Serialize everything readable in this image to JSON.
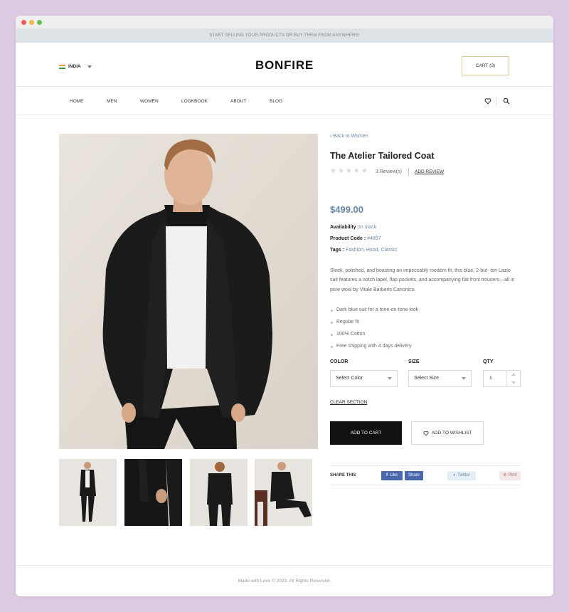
{
  "announcement": "START SELLING YOUR PRODUCTS OR BUY THEM FROM ANYWHERE!",
  "header": {
    "country": "INDIA",
    "logo": "BONFIRE",
    "cart": "CART (3)"
  },
  "nav": {
    "items": [
      "HOME",
      "MEN",
      "WOMEN",
      "LOOKBOOK",
      "ABOUT",
      "BLOG"
    ],
    "icons": [
      "heart-icon",
      "search-icon"
    ]
  },
  "product": {
    "back_label": "Back to Women",
    "title": "The Atelier Tailored Coat",
    "rating": 0,
    "reviews": "3 Review(s)",
    "add_review": "ADD REVIEW",
    "price": "$499.00",
    "availability_label": "Availability :",
    "availability_value": "In stock",
    "code_label": "Product Code :",
    "code_value": "#4657",
    "tags_label": "Tags :",
    "tags_value": "Fashion, Hood, Classic",
    "description": "Sleek, polished, and boasting an impeccably modern fit, this blue, 2-but- ton Lazio suit features a notch lapel, flap pockets, and accompanying flat front trousers—all in pure wool by Vitale Barberis Canonico.",
    "features": [
      "Dark blue suit for a tone-on-tone look",
      "Regular fit",
      "100% Cotton",
      "Free shipping with 4 days delivery"
    ],
    "color_label": "COLOR",
    "color_value": "Select Color",
    "size_label": "SIZE",
    "size_value": "Select Size",
    "qty_label": "QTY",
    "qty_value": "1",
    "clear_label": "CLEAR SECTION",
    "add_to_cart": "ADD TO CART",
    "add_to_wishlist": "ADD TO WISHLIST"
  },
  "share": {
    "label": "SHARE THIS",
    "like": "Like",
    "share": "Share",
    "twitter": "Twitter",
    "pinit": "Pinit"
  },
  "footer": "Made with Love © 2023. All Rights Reserved.",
  "colors": {
    "accent": "#6a87a6",
    "button_dark": "#111111",
    "cart_border": "#d8c89a",
    "facebook": "#4a67ad"
  }
}
